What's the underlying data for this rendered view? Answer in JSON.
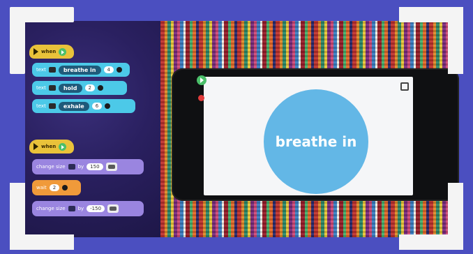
{
  "blocks": {
    "group1": {
      "hat_label": "when",
      "rows": [
        {
          "cmd": "text",
          "text_value": "breathe in",
          "num": "4"
        },
        {
          "cmd": "text",
          "text_value": "hold",
          "num": "2"
        },
        {
          "cmd": "text",
          "text_value": "exhale",
          "num": "6"
        }
      ]
    },
    "group2": {
      "hat_label": "when",
      "change1": {
        "cmd": "change size",
        "by": "by",
        "value": "150"
      },
      "wait": {
        "cmd": "wait",
        "num": "2"
      },
      "change2": {
        "cmd": "change size",
        "by": "by",
        "value": "-150"
      }
    }
  },
  "stage": {
    "circle_text": "breathe in",
    "circle_color": "#63b7e6"
  },
  "theme": {
    "frame": "#4b4fc0",
    "hat": "#e9c23a",
    "text_block": "#4cc9e8",
    "motion_block": "#9a85e0",
    "control_block": "#f09a3a",
    "run": "#4bbf6a",
    "stop": "#e23b3b"
  },
  "icons": [
    "play-icon",
    "stop-icon",
    "expand-icon",
    "scale-icon"
  ]
}
